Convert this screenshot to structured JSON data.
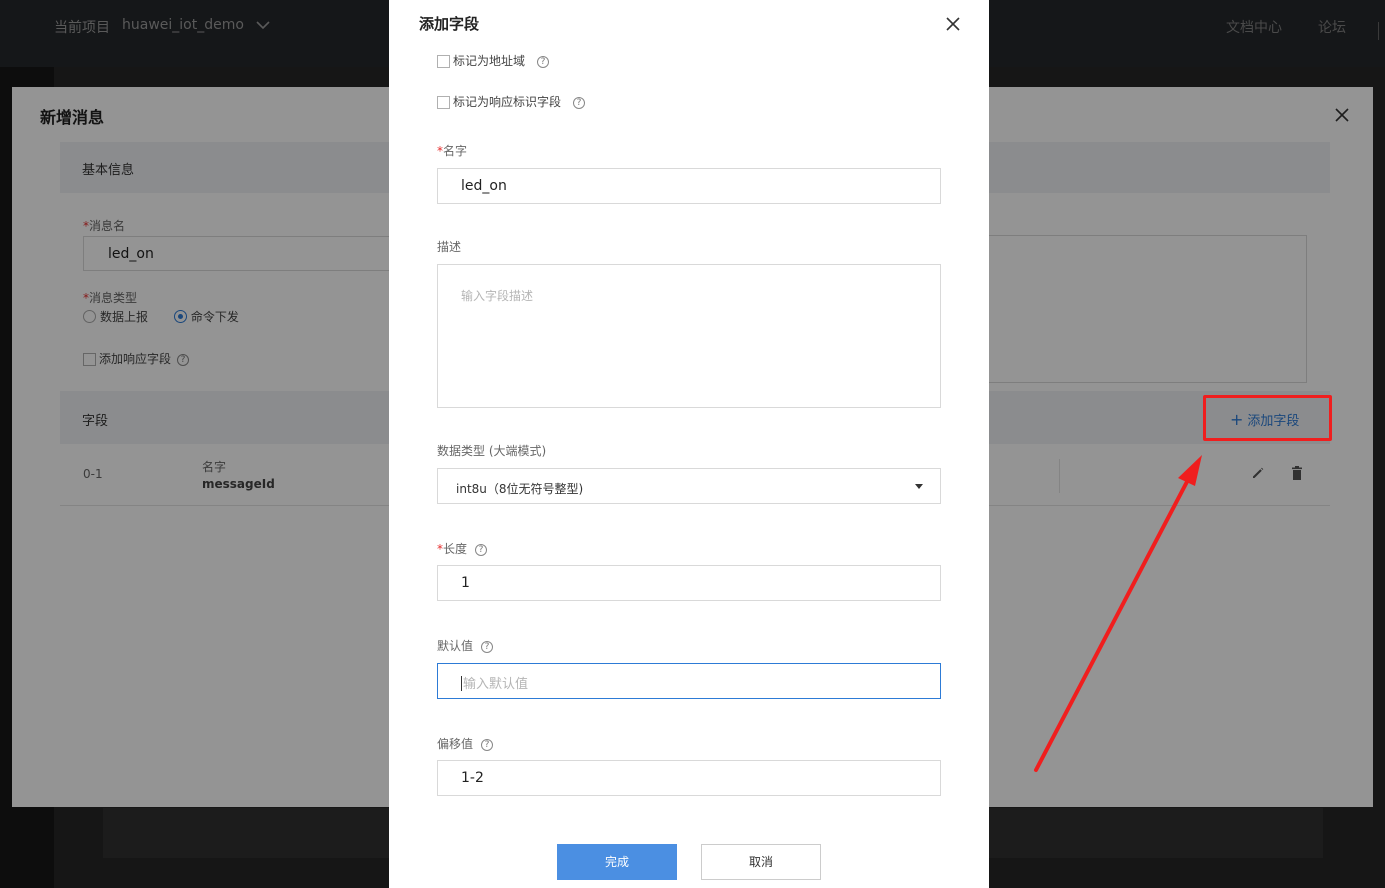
{
  "topbar": {
    "project_label": "当前项目",
    "project_name": "huawei_iot_demo",
    "nav": [
      "文档中心",
      "论坛"
    ]
  },
  "back_modal": {
    "title": "新增消息",
    "basic_section": "基本信息",
    "message_name_label": "消息名",
    "message_name_value": "led_on",
    "message_type_label": "消息类型",
    "message_type_options": [
      "数据上报",
      "命令下发"
    ],
    "message_type_selected": "命令下发",
    "add_response_field_label": "添加响应字段",
    "fields_section": "字段",
    "add_field_label": "添加字段",
    "rows": [
      {
        "index": "0-1",
        "name_label": "名字",
        "name_value": "messageId"
      }
    ]
  },
  "dialog": {
    "title": "添加字段",
    "mark_address_label": "标记为地址域",
    "mark_response_label": "标记为响应标识字段",
    "name_label": "名字",
    "name_value": "led_on",
    "desc_label": "描述",
    "desc_placeholder": "输入字段描述",
    "datatype_label": "数据类型 (大端模式)",
    "datatype_value": "int8u（8位无符号整型)",
    "length_label": "长度",
    "length_value": "1",
    "default_label": "默认值",
    "default_placeholder": "输入默认值",
    "offset_label": "偏移值",
    "offset_value": "1-2",
    "ok_label": "完成",
    "cancel_label": "取消"
  },
  "colors": {
    "accent": "#2d7bd6",
    "primary_button": "#4b8fe2",
    "annotation_red": "#f01e1e",
    "required": "#e62c2c"
  }
}
